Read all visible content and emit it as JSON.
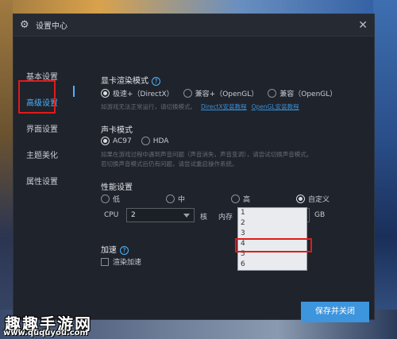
{
  "window": {
    "title": "设置中心",
    "title_icon": "gear-icon",
    "close": "✕"
  },
  "sidebar": {
    "items": [
      {
        "label": "基本设置",
        "active": false
      },
      {
        "label": "高级设置",
        "active": true
      },
      {
        "label": "界面设置",
        "active": false
      },
      {
        "label": "主题美化",
        "active": false
      },
      {
        "label": "属性设置",
        "active": false
      }
    ]
  },
  "gpu": {
    "title": "显卡渲染模式",
    "options": [
      "极速+（DirectX）",
      "兼容+（OpenGL）",
      "兼容（OpenGL）"
    ],
    "selected": 0,
    "hint": "如游戏无法正常运行，请切换模式。",
    "links": [
      "DirectX安装教程",
      "OpenGL安装教程"
    ]
  },
  "sound": {
    "title": "声卡模式",
    "options": [
      "AC97",
      "HDA"
    ],
    "selected": 0,
    "hint_line1": "如果在游戏过程中遇到声音问题（声音消失，声音变调），请尝试切换声音模式。",
    "hint_line2": "若切换声音模式后仍有问题，请尝试重启操作系统。"
  },
  "performance": {
    "title": "性能设置",
    "options": [
      "低",
      "中",
      "高",
      "自定义"
    ],
    "selected": 3,
    "cpu_label": "CPU",
    "cpu_value": "2",
    "cpu_unit": "核",
    "mem_label": "内存",
    "mem_value": "2",
    "mem_unit": "GB",
    "mem_options": [
      "1",
      "2",
      "3",
      "4",
      "5",
      "6"
    ]
  },
  "accel": {
    "title": "加速",
    "checkbox_label": "渲染加速",
    "checked": false
  },
  "save_button": "保存并关闭",
  "watermark": {
    "title": "趣趣手游网",
    "url": "www.ququyou.com"
  },
  "colors": {
    "accent": "#3d95dd",
    "highlight_border": "#e01a1a",
    "bg": "#1f232b"
  }
}
